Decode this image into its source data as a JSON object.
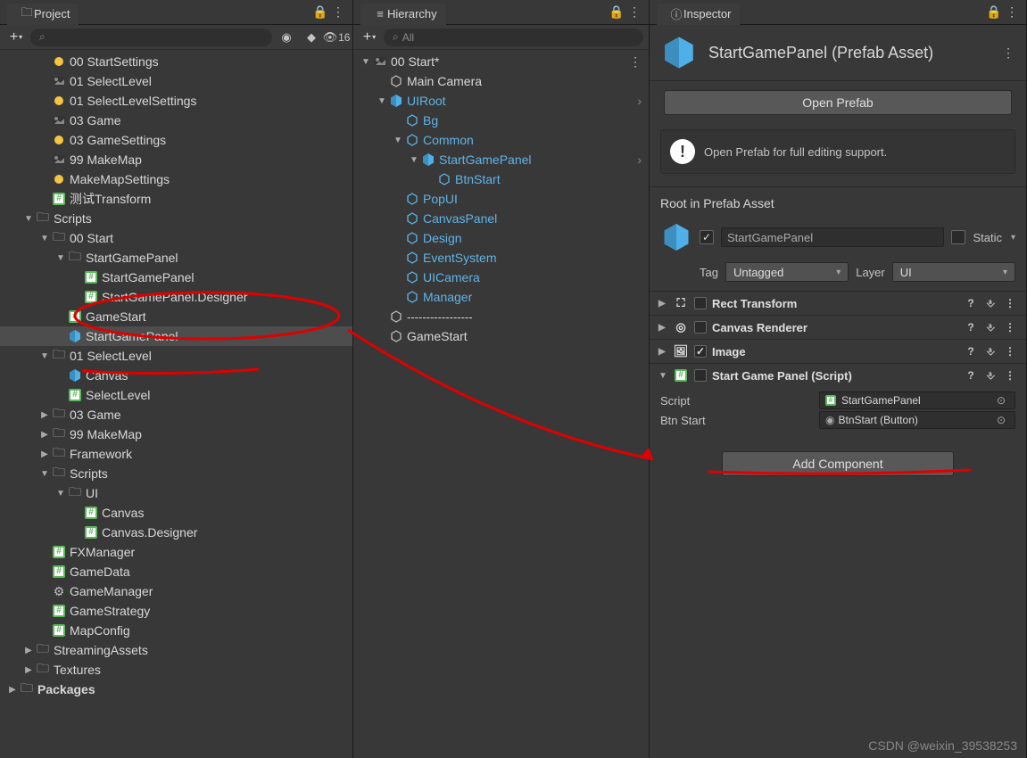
{
  "project": {
    "tab": "Project",
    "search_placeholder": "",
    "search_glyph": "⌕",
    "hidden_count": "16",
    "items": [
      {
        "label": "00 StartSettings",
        "icon": "yellow",
        "depth": 2
      },
      {
        "label": "01 SelectLevel",
        "icon": "scene",
        "depth": 2
      },
      {
        "label": "01 SelectLevelSettings",
        "icon": "yellow",
        "depth": 2
      },
      {
        "label": "03 Game",
        "icon": "scene",
        "depth": 2
      },
      {
        "label": "03 GameSettings",
        "icon": "yellow",
        "depth": 2
      },
      {
        "label": "99 MakeMap",
        "icon": "scene",
        "depth": 2
      },
      {
        "label": "MakeMapSettings",
        "icon": "yellow",
        "depth": 2
      },
      {
        "label": "测试Transform",
        "icon": "script",
        "depth": 2
      },
      {
        "label": "Scripts",
        "icon": "folder",
        "depth": 1,
        "arrow": "expanded"
      },
      {
        "label": "00 Start",
        "icon": "folder",
        "depth": 2,
        "arrow": "expanded"
      },
      {
        "label": "StartGamePanel",
        "icon": "folder",
        "depth": 3,
        "arrow": "expanded"
      },
      {
        "label": "StartGamePanel",
        "icon": "script",
        "depth": 4
      },
      {
        "label": "StartGamePanel.Designer",
        "icon": "script",
        "depth": 4
      },
      {
        "label": "GameStart",
        "icon": "script",
        "depth": 3
      },
      {
        "label": "StartGamePanel",
        "icon": "prefab",
        "depth": 3,
        "selected": true
      },
      {
        "label": "01 SelectLevel",
        "icon": "folder",
        "depth": 2,
        "arrow": "expanded"
      },
      {
        "label": "Canvas",
        "icon": "prefab",
        "depth": 3
      },
      {
        "label": "SelectLevel",
        "icon": "script",
        "depth": 3
      },
      {
        "label": "03 Game",
        "icon": "folder",
        "depth": 2,
        "arrow": "collapsed"
      },
      {
        "label": "99 MakeMap",
        "icon": "folder",
        "depth": 2,
        "arrow": "collapsed"
      },
      {
        "label": "Framework",
        "icon": "folder",
        "depth": 2,
        "arrow": "collapsed"
      },
      {
        "label": "Scripts",
        "icon": "folder",
        "depth": 2,
        "arrow": "expanded"
      },
      {
        "label": "UI",
        "icon": "folder",
        "depth": 3,
        "arrow": "expanded"
      },
      {
        "label": "Canvas",
        "icon": "script",
        "depth": 4
      },
      {
        "label": "Canvas.Designer",
        "icon": "script",
        "depth": 4
      },
      {
        "label": "FXManager",
        "icon": "script",
        "depth": 2
      },
      {
        "label": "GameData",
        "icon": "script",
        "depth": 2
      },
      {
        "label": "GameManager",
        "icon": "gear",
        "depth": 2
      },
      {
        "label": "GameStrategy",
        "icon": "script",
        "depth": 2
      },
      {
        "label": "MapConfig",
        "icon": "script",
        "depth": 2
      },
      {
        "label": "StreamingAssets",
        "icon": "folder",
        "depth": 1,
        "arrow": "collapsed"
      },
      {
        "label": "Textures",
        "icon": "folder",
        "depth": 1,
        "arrow": "collapsed"
      },
      {
        "label": "Packages",
        "icon": "folder",
        "depth": 0,
        "arrow": "collapsed",
        "bold": true
      }
    ]
  },
  "hierarchy": {
    "tab": "Hierarchy",
    "search_placeholder": "All",
    "items": [
      {
        "label": "00 Start*",
        "icon": "scene",
        "depth": 0,
        "arrow": "expanded",
        "menu": true
      },
      {
        "label": "Main Camera",
        "icon": "go",
        "depth": 1
      },
      {
        "label": "UIRoot",
        "icon": "prefab",
        "depth": 1,
        "arrow": "expanded",
        "blue": true,
        "nav": true
      },
      {
        "label": "Bg",
        "icon": "go-blue",
        "depth": 2,
        "blue": true
      },
      {
        "label": "Common",
        "icon": "go-blue",
        "depth": 2,
        "arrow": "expanded",
        "blue": true
      },
      {
        "label": "StartGamePanel",
        "icon": "prefab",
        "depth": 3,
        "arrow": "expanded",
        "blue": true,
        "nav": true
      },
      {
        "label": "BtnStart",
        "icon": "go-blue",
        "depth": 4,
        "blue": true
      },
      {
        "label": "PopUI",
        "icon": "go-blue",
        "depth": 2,
        "blue": true
      },
      {
        "label": "CanvasPanel",
        "icon": "go-blue",
        "depth": 2,
        "blue": true
      },
      {
        "label": "Design",
        "icon": "go-blue",
        "depth": 2,
        "blue": true
      },
      {
        "label": "EventSystem",
        "icon": "go-blue",
        "depth": 2,
        "blue": true
      },
      {
        "label": "UICamera",
        "icon": "go-blue",
        "depth": 2,
        "blue": true
      },
      {
        "label": "Manager",
        "icon": "go-blue",
        "depth": 2,
        "blue": true
      },
      {
        "label": "-----------------",
        "icon": "go",
        "depth": 1,
        "divider": true
      },
      {
        "label": "GameStart",
        "icon": "go",
        "depth": 1
      }
    ]
  },
  "inspector": {
    "tab": "Inspector",
    "title": "StartGamePanel (Prefab Asset)",
    "open_btn": "Open Prefab",
    "info_text": "Open Prefab for full editing support.",
    "root_label": "Root in Prefab Asset",
    "object_name": "StartGamePanel",
    "static_label": "Static",
    "tag_label": "Tag",
    "tag_value": "Untagged",
    "layer_label": "Layer",
    "layer_value": "UI",
    "components": [
      {
        "name": "Rect Transform",
        "icon": "rect",
        "check": false,
        "fold": "collapsed"
      },
      {
        "name": "Canvas Renderer",
        "icon": "eye",
        "check": false,
        "fold": "collapsed"
      },
      {
        "name": "Image",
        "icon": "image",
        "check": true,
        "fold": "collapsed"
      },
      {
        "name": "Start Game Panel (Script)",
        "icon": "script",
        "check": false,
        "fold": "expanded",
        "props": [
          {
            "name": "Script",
            "value": "StartGamePanel",
            "type": "script"
          },
          {
            "name": "Btn Start",
            "value": "BtnStart (Button)",
            "type": "obj"
          }
        ]
      }
    ],
    "add_component": "Add Component"
  },
  "watermark": "CSDN @weixin_39538253"
}
